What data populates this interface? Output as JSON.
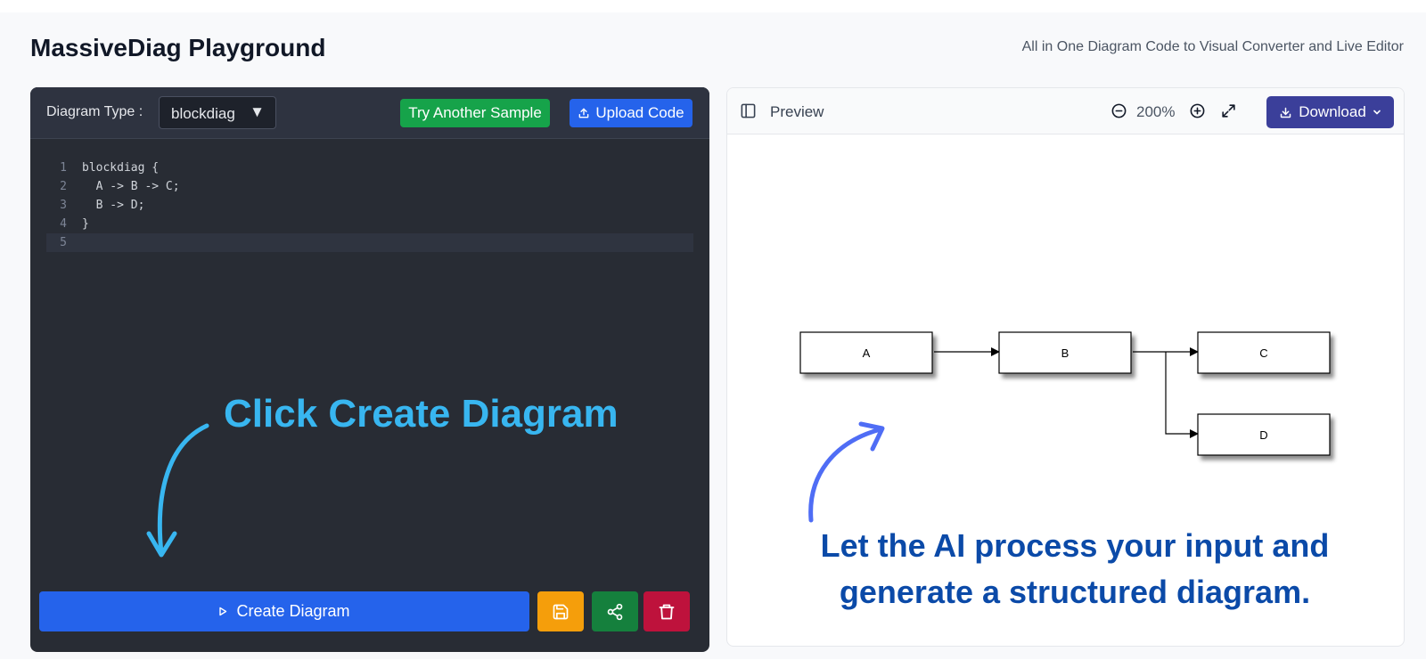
{
  "header": {
    "title": "MassiveDiag Playground",
    "tagline": "All in One Diagram Code to Visual Converter and Live Editor"
  },
  "editor": {
    "diagram_type_label": "Diagram Type :",
    "diagram_type_value": "blockdiag",
    "try_sample_label": "Try Another Sample",
    "upload_label": "Upload Code",
    "code_lines": [
      {
        "num": "1",
        "text": "blockdiag {"
      },
      {
        "num": "2",
        "text": "  A -> B -> C;"
      },
      {
        "num": "3",
        "text": "  B -> D;"
      },
      {
        "num": "4",
        "text": "}"
      },
      {
        "num": "5",
        "text": ""
      }
    ],
    "annotation": "Click Create Diagram",
    "create_label": "Create Diagram"
  },
  "preview": {
    "label": "Preview",
    "zoom": "200%",
    "download_label": "Download",
    "nodes": [
      "A",
      "B",
      "C",
      "D"
    ],
    "annotation_line1": "Let the AI process your input and",
    "annotation_line2": "generate a structured diagram."
  },
  "colors": {
    "editor_bg": "#282c34",
    "primary_blue": "#2563eb",
    "sample_green": "#16a34a",
    "save_amber": "#f59e0b",
    "share_green": "#15803d",
    "delete_red": "#be123c",
    "download_indigo": "#3b3f9a",
    "annotation_cyan": "#38b6f0",
    "annotation_navy": "#0b4aa8"
  },
  "icons": [
    "upload-icon",
    "play-icon",
    "save-icon",
    "share-icon",
    "trash-icon",
    "sidebar-icon",
    "zoom-out-icon",
    "zoom-in-icon",
    "fullscreen-icon",
    "download-icon",
    "chevron-down-icon"
  ]
}
